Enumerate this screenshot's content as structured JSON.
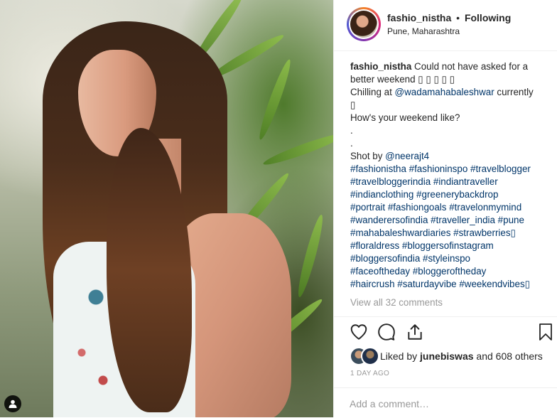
{
  "post": {
    "username": "fashio_nistha",
    "separator": "•",
    "follow_state": "Following",
    "location": "Pune, Maharashtra"
  },
  "caption": {
    "username": "fashio_nistha",
    "lines": [
      " Could not have asked for a",
      "better weekend ▯ ▯ ▯ ▯ ▯",
      "Chilling at ",
      "@wadamahabaleshwar",
      " currently",
      "▯",
      "How's your weekend like?",
      ".",
      ".",
      "Shot by ",
      "@neerajt4"
    ],
    "hashtag_lines": [
      "#fashionistha #fashioninspo #travelblogger",
      "#travelbloggerindia #indiantraveller",
      "#indianclothing #greenerybackdrop",
      "#portrait #fashiongoals #travelonmymind",
      "#wanderersofindia #traveller_india #pune",
      "#mahabaleshwardiaries #strawberries▯",
      "#floraldress #bloggersofinstagram",
      "#bloggersofindia #styleinspo",
      "#faceoftheday #bloggeroftheday",
      "#haircrush #saturdayvibe #weekendvibes▯"
    ]
  },
  "comments": {
    "view_all": "View all 32 comments"
  },
  "likes": {
    "prefix": "Liked by ",
    "user": "junebiswas",
    "suffix": " and 608 others"
  },
  "timestamp": "1 DAY AGO",
  "comment_box": {
    "placeholder": "Add a comment…"
  },
  "icons": {
    "like": "heart-icon",
    "comment": "comment-icon",
    "share": "share-icon",
    "save": "bookmark-icon",
    "user_tag": "user-tag-icon"
  },
  "colors": {
    "hashtag": "#003569",
    "muted": "#999999",
    "text": "#262626"
  }
}
